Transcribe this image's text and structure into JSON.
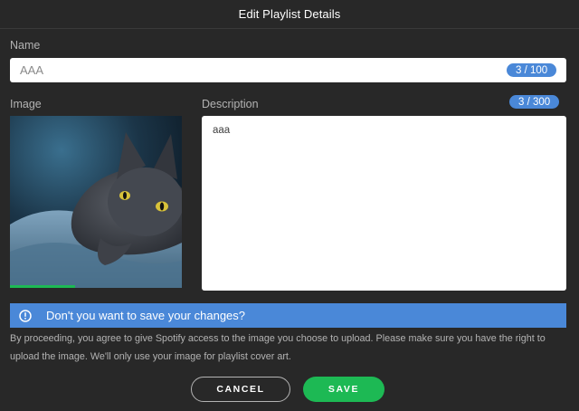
{
  "dialog": {
    "title": "Edit Playlist Details"
  },
  "name": {
    "label": "Name",
    "value": "AAA",
    "counter": "3 / 100"
  },
  "image": {
    "label": "Image",
    "upload_progress": 0.38
  },
  "description": {
    "label": "Description",
    "value": "aaa",
    "counter": "3 / 300"
  },
  "banner": {
    "text": "Don't you want to save your changes?",
    "icon": "info-icon"
  },
  "disclaimer": "By proceeding, you agree to give Spotify access to the image you choose to upload. Please make sure you have the right to upload the image. We'll only use your image for playlist cover art.",
  "buttons": {
    "cancel": "CANCEL",
    "save": "SAVE"
  },
  "colors": {
    "background": "#282828",
    "accent_blue": "#4a88d8",
    "green": "#1db954",
    "field": "#ffffff"
  }
}
